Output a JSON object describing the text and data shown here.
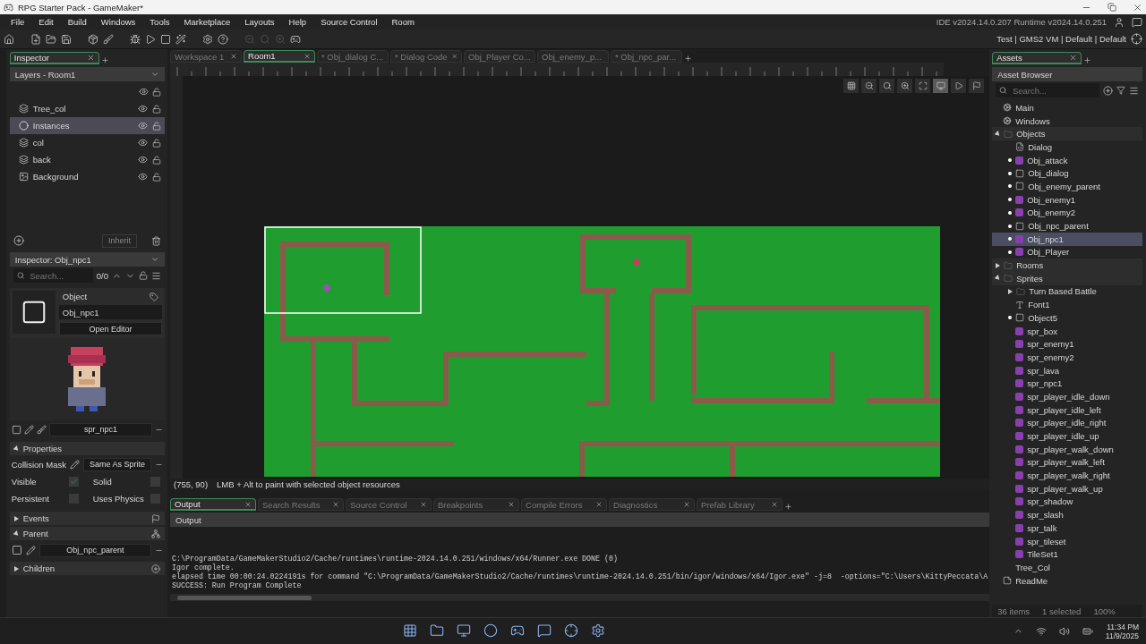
{
  "window": {
    "title": "RPG Starter Pack - GameMaker*"
  },
  "menu": [
    "File",
    "Edit",
    "Build",
    "Windows",
    "Tools",
    "Marketplace",
    "Layouts",
    "Help",
    "Source Control",
    "Room"
  ],
  "version": "IDE v2024.14.0.207  Runtime v2024.14.0.251",
  "targets": "Test | GMS2 VM | Default | Default",
  "left": {
    "tab": "Inspector",
    "layers_title": "Layers - Room1",
    "layers": [
      {
        "name": "Tree_col",
        "kind": "tile",
        "selected": false
      },
      {
        "name": "Instances",
        "kind": "instance",
        "selected": true
      },
      {
        "name": "col",
        "kind": "tile",
        "selected": false
      },
      {
        "name": "back",
        "kind": "tile",
        "selected": false
      },
      {
        "name": "Background",
        "kind": "background",
        "selected": false
      }
    ],
    "inherit": "Inherit",
    "inspector_title": "Inspector: Obj_npc1",
    "search": {
      "placeholder": "Search..."
    },
    "match_count": "0/0",
    "object_label": "Object",
    "object_name": "Obj_npc1",
    "open_editor": "Open Editor",
    "sprite": "spr_npc1",
    "properties": {
      "title": "Properties",
      "expanded": true,
      "collision_label": "Collision Mask",
      "collision_value": "Same As Sprite",
      "flags": [
        {
          "label": "Visible",
          "checked": true
        },
        {
          "label": "Solid",
          "checked": false
        },
        {
          "label": "Persistent",
          "checked": false
        },
        {
          "label": "Uses Physics",
          "checked": false
        }
      ]
    },
    "events": {
      "title": "Events",
      "expanded": false
    },
    "parent": {
      "title": "Parent",
      "expanded": true,
      "value": "Obj_npc_parent"
    },
    "children": {
      "title": "Children",
      "expanded": false
    }
  },
  "doc_tabs": [
    {
      "label": "Workspace 1",
      "selected": false
    },
    {
      "label": "Room1",
      "selected": true
    },
    {
      "label": "* Obj_dialog C...",
      "selected": false
    },
    {
      "label": "* Dialog Code",
      "selected": false
    },
    {
      "label": "Obj_Player Co...",
      "selected": false
    },
    {
      "label": "Obj_enemy_p...",
      "selected": false
    },
    {
      "label": "* Obj_npc_par...",
      "selected": false
    }
  ],
  "status": {
    "coords": "(755, 90)",
    "hint": "LMB + Alt to paint with selected object resources"
  },
  "output_tabs": [
    {
      "label": "Output",
      "selected": true
    },
    {
      "label": "Search Results",
      "selected": false
    },
    {
      "label": "Source Control",
      "selected": false
    },
    {
      "label": "Breakpoints",
      "selected": false
    },
    {
      "label": "Compile Errors",
      "selected": false
    },
    {
      "label": "Diagnostics",
      "selected": false
    },
    {
      "label": "Prefab Library",
      "selected": false
    }
  ],
  "output_title": "Output",
  "output_lines": [
    "C:\\ProgramData/GameMakerStudio2/Cache/runtimes\\runtime-2024.14.0.251/windows/x64/Runner.exe DONE (0)",
    "Igor complete.",
    "elapsed time 00:00:24.0224191s for command \"C:\\ProgramData/GameMakerStudio2/Cache/runtimes\\runtime-2024.14.0.251/bin/igor/windows/x64/Igor.exe\" -j=8  -options=\"C:\\Users\\KittyPeccata\\A",
    "SUCCESS: Run Program Complete"
  ],
  "assets": {
    "tab": "Assets",
    "title": "Asset Browser",
    "search": {
      "placeholder": "Search..."
    },
    "tree": [
      {
        "label": "Main",
        "kind": "option",
        "dot": false,
        "selected": false
      },
      {
        "label": "Windows",
        "kind": "option",
        "dot": false,
        "selected": false
      },
      {
        "label": "Objects",
        "kind": "folder",
        "expanded": true,
        "selected": false,
        "children": [
          {
            "label": "Dialog",
            "kind": "script",
            "dot": false,
            "selected": false
          },
          {
            "label": "Obj_attack",
            "kind": "sprite",
            "dot": true,
            "selected": false
          },
          {
            "label": "Obj_dialog",
            "kind": "object",
            "dot": true,
            "selected": false
          },
          {
            "label": "Obj_enemy_parent",
            "kind": "object",
            "dot": true,
            "selected": false
          },
          {
            "label": "Obj_enemy1",
            "kind": "sprite",
            "dot": true,
            "selected": false
          },
          {
            "label": "Obj_enemy2",
            "kind": "sprite",
            "dot": true,
            "selected": false
          },
          {
            "label": "Obj_npc_parent",
            "kind": "object",
            "dot": true,
            "selected": false
          },
          {
            "label": "Obj_npc1",
            "kind": "sprite",
            "dot": true,
            "selected": true
          },
          {
            "label": "Obj_Player",
            "kind": "sprite",
            "dot": true,
            "selected": false
          }
        ]
      },
      {
        "label": "Rooms",
        "kind": "folder",
        "expanded": false,
        "selected": false
      },
      {
        "label": "Sprites",
        "kind": "folder",
        "expanded": true,
        "selected": false,
        "children": [
          {
            "label": "Turn Based Battle",
            "kind": "folder",
            "expanded": false,
            "selected": false
          },
          {
            "label": "Font1",
            "kind": "font",
            "dot": false,
            "selected": false
          },
          {
            "label": "Object5",
            "kind": "object",
            "dot": true,
            "selected": false
          },
          {
            "label": "spr_box",
            "kind": "sprite",
            "dot": false,
            "selected": false
          },
          {
            "label": "spr_enemy1",
            "kind": "sprite",
            "dot": false,
            "selected": false
          },
          {
            "label": "spr_enemy2",
            "kind": "sprite",
            "dot": false,
            "selected": false
          },
          {
            "label": "spr_lava",
            "kind": "sprite",
            "dot": false,
            "selected": false
          },
          {
            "label": "spr_npc1",
            "kind": "sprite",
            "dot": false,
            "selected": false
          },
          {
            "label": "spr_player_idle_down",
            "kind": "sprite",
            "dot": false,
            "selected": false
          },
          {
            "label": "spr_player_idle_left",
            "kind": "sprite",
            "dot": false,
            "selected": false
          },
          {
            "label": "spr_player_idle_right",
            "kind": "sprite",
            "dot": false,
            "selected": false
          },
          {
            "label": "spr_player_idle_up",
            "kind": "sprite",
            "dot": false,
            "selected": false
          },
          {
            "label": "spr_player_walk_down",
            "kind": "sprite",
            "dot": false,
            "selected": false
          },
          {
            "label": "spr_player_walk_left",
            "kind": "sprite",
            "dot": false,
            "selected": false
          },
          {
            "label": "spr_player_walk_right",
            "kind": "sprite",
            "dot": false,
            "selected": false
          },
          {
            "label": "spr_player_walk_up",
            "kind": "sprite",
            "dot": false,
            "selected": false
          },
          {
            "label": "spr_shadow",
            "kind": "sprite",
            "dot": false,
            "selected": false
          },
          {
            "label": "spr_slash",
            "kind": "sprite",
            "dot": false,
            "selected": false
          },
          {
            "label": "spr_talk",
            "kind": "sprite",
            "dot": false,
            "selected": false
          },
          {
            "label": "spr_tileset",
            "kind": "sprite",
            "dot": false,
            "selected": false
          },
          {
            "label": "TileSet1",
            "kind": "sprite",
            "dot": false,
            "selected": false
          },
          {
            "label": "Tree_Col",
            "kind": "none",
            "dot": false,
            "selected": false
          }
        ]
      },
      {
        "label": "ReadMe",
        "kind": "note",
        "dot": false,
        "selected": false
      }
    ],
    "footer": [
      "36 items",
      "1 selected",
      "100%"
    ]
  },
  "taskbar": {
    "time": "11:34 PM",
    "date": "11/9/2025"
  }
}
